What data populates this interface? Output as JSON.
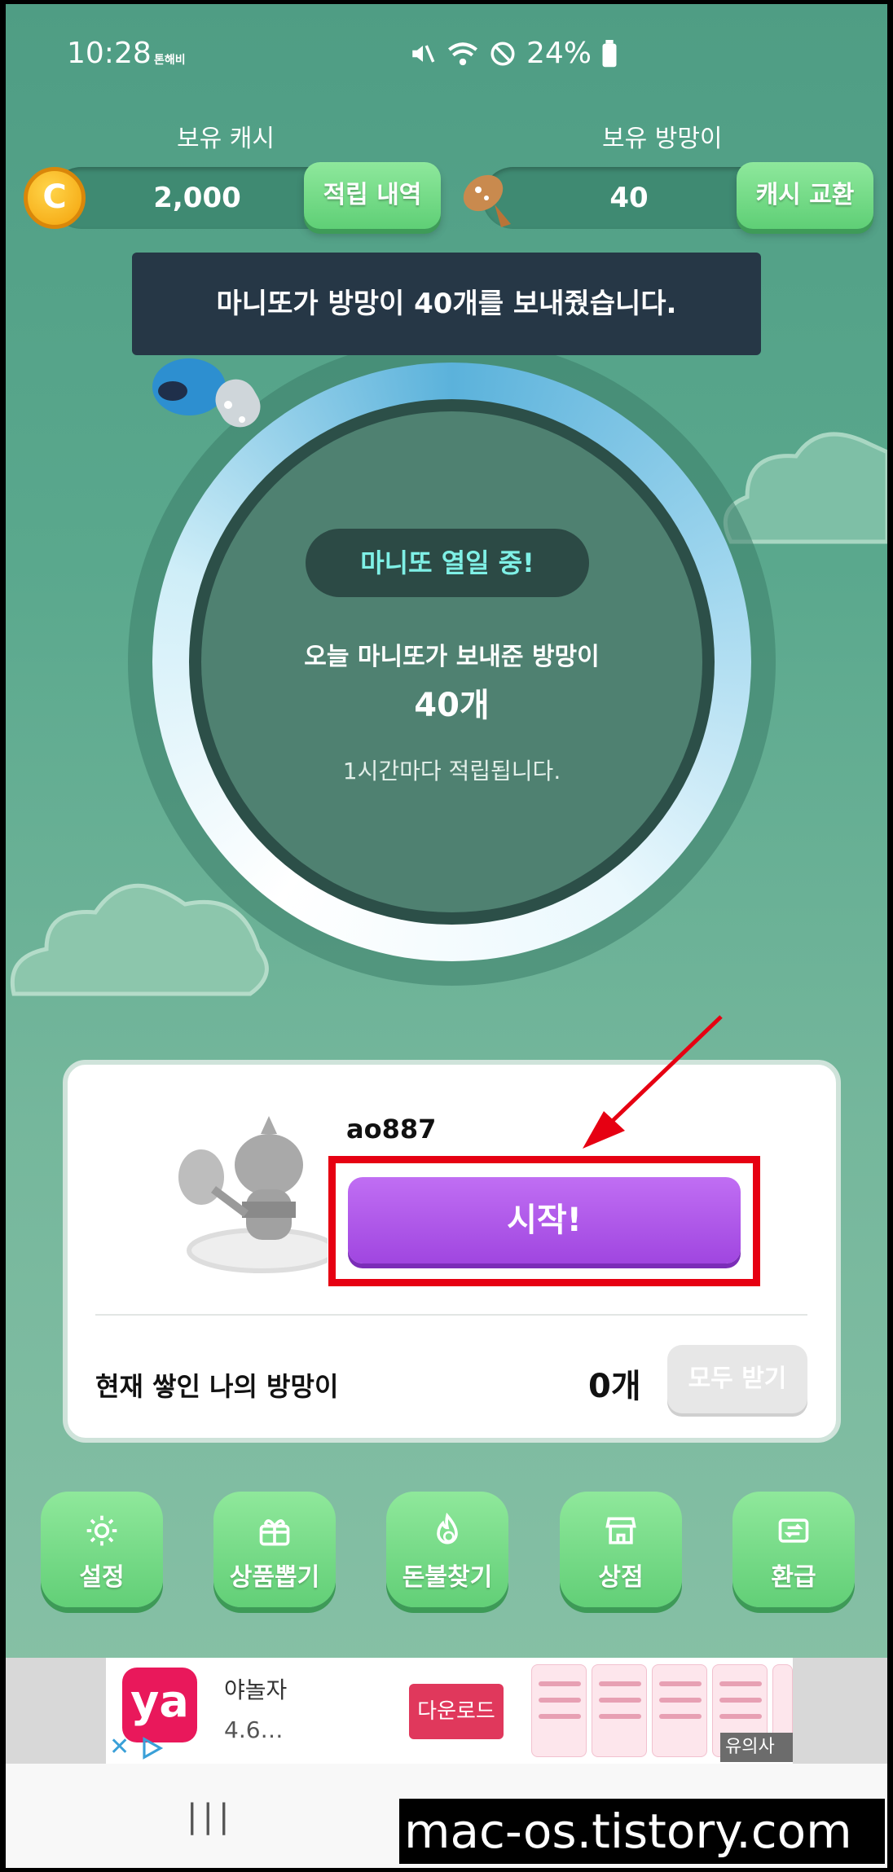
{
  "status_bar": {
    "time": "10:28",
    "carrier": "톤해비",
    "battery": "24%"
  },
  "top": {
    "cash_label": "보유 캐시",
    "cash_value": "2,000",
    "cash_button": "적립 내역",
    "coin_letter": "C",
    "bait_label": "보유 방망이",
    "bait_value": "40",
    "bait_button": "캐시 교환"
  },
  "toast": "마니또가 방망이 40개를 보내줬습니다.",
  "ring": {
    "badge": "마니또 열일 중!",
    "line1": "오늘 마니또가 보내준 방망이",
    "line2": "40개",
    "line3": "1시간마다 적립됩니다."
  },
  "card": {
    "username": "ao887",
    "start_button": "시작!",
    "my_label": "현재 쌓인 나의 방망이",
    "my_value": "0개",
    "get_all_button": "모두 받기"
  },
  "nav": [
    {
      "label": "설정",
      "icon": "gear-icon"
    },
    {
      "label": "상품뽑기",
      "icon": "gift-icon"
    },
    {
      "label": "돈불찾기",
      "icon": "fire-coin-icon"
    },
    {
      "label": "상점",
      "icon": "store-icon"
    },
    {
      "label": "환급",
      "icon": "exchange-icon"
    }
  ],
  "ad": {
    "logo": "ya",
    "name": "야놀자",
    "rating": "4.6…",
    "download": "다운로드",
    "notice": "유의사항"
  },
  "watermark": "mac-os.tistory.com",
  "colors": {
    "accent_green": "#62cf77",
    "start_purple": "#a046e0",
    "highlight_red": "#e60012",
    "toast_bg": "#263746"
  }
}
